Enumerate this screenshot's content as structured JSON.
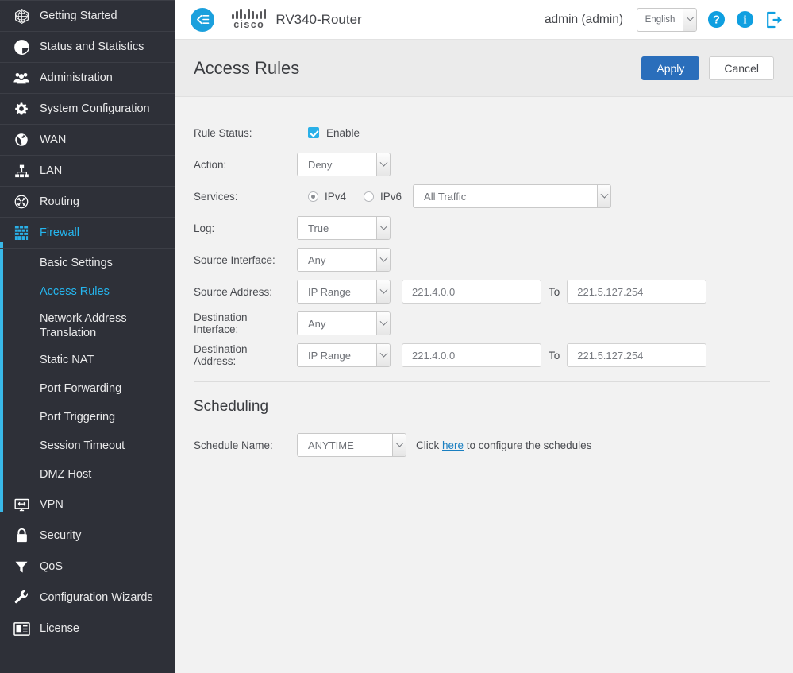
{
  "header": {
    "menu_toggle_icon": "menu-collapse-icon",
    "brand": "cisco",
    "device_name": "RV340-Router",
    "user": "admin (admin)",
    "language": "English",
    "help_icon": "help-circle-icon",
    "info_icon": "info-circle-icon",
    "logout_icon": "logout-icon"
  },
  "sidebar": {
    "items": [
      {
        "label": "Getting Started",
        "icon": "globe-mesh-icon"
      },
      {
        "label": "Status and Statistics",
        "icon": "pie-chart-icon"
      },
      {
        "label": "Administration",
        "icon": "people-icon"
      },
      {
        "label": "System Configuration",
        "icon": "gear-icon"
      },
      {
        "label": "WAN",
        "icon": "globe-icon"
      },
      {
        "label": "LAN",
        "icon": "network-tree-icon"
      },
      {
        "label": "Routing",
        "icon": "routing-circle-icon"
      },
      {
        "label": "Firewall",
        "icon": "firewall-brick-icon"
      }
    ],
    "firewall_children": [
      {
        "label": "Basic Settings"
      },
      {
        "label": "Access Rules"
      },
      {
        "label": "Network Address Translation"
      },
      {
        "label": "Static NAT"
      },
      {
        "label": "Port Forwarding"
      },
      {
        "label": "Port Triggering"
      },
      {
        "label": "Session Timeout"
      },
      {
        "label": "DMZ Host"
      }
    ],
    "bottom_items": [
      {
        "label": "VPN",
        "icon": "vpn-monitor-icon"
      },
      {
        "label": "Security",
        "icon": "lock-icon"
      },
      {
        "label": "QoS",
        "icon": "funnel-icon"
      },
      {
        "label": "Configuration Wizards",
        "icon": "wrench-icon"
      },
      {
        "label": "License",
        "icon": "license-card-icon"
      }
    ],
    "active_parent": "Firewall",
    "active_child": "Access Rules",
    "accent_color": "#39b8e8",
    "active_text_color": "#25b6ef",
    "background": "#2e3038"
  },
  "page": {
    "title": "Access Rules",
    "apply_label": "Apply",
    "cancel_label": "Cancel",
    "primary_button_color": "#2a6ebb"
  },
  "form": {
    "rule_status": {
      "label": "Rule Status:",
      "checkbox_label": "Enable",
      "checked": true
    },
    "action": {
      "label": "Action:",
      "value": "Deny"
    },
    "services": {
      "label": "Services:",
      "ipv4_label": "IPv4",
      "ipv6_label": "IPv6",
      "selected_protocol": "IPv4",
      "value": "All Traffic"
    },
    "log": {
      "label": "Log:",
      "value": "True"
    },
    "source_interface": {
      "label": "Source Interface:",
      "value": "Any"
    },
    "source_address": {
      "label": "Source Address:",
      "type": "IP Range",
      "from": "221.4.0.0",
      "to_label": "To",
      "to": "221.5.127.254"
    },
    "destination_interface": {
      "label": "Destination Interface:",
      "value": "Any"
    },
    "destination_address": {
      "label": "Destination Address:",
      "type": "IP Range",
      "from": "221.4.0.0",
      "to_label": "To",
      "to": "221.5.127.254"
    }
  },
  "scheduling": {
    "title": "Scheduling",
    "schedule_name_label": "Schedule Name:",
    "schedule_value": "ANYTIME",
    "hint_prefix": "Click ",
    "hint_link": "here",
    "hint_suffix": " to configure the schedules"
  }
}
